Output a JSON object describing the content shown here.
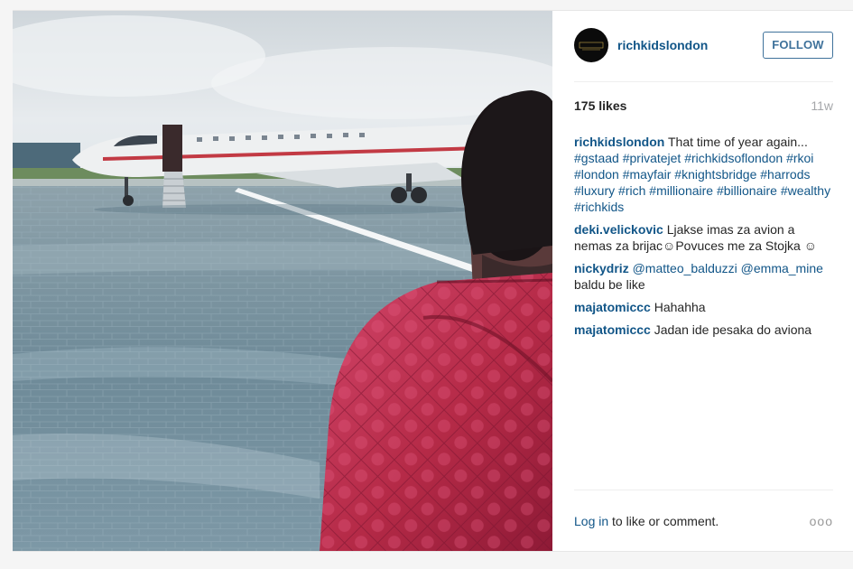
{
  "post": {
    "username": "richkidslondon",
    "avatar_text": "Rich Kids Of London",
    "follow_label": "FOLLOW",
    "likes": "175 likes",
    "time": "11w",
    "caption": {
      "user": "richkidslondon",
      "text": "That time of year again...",
      "hashtags": [
        "#gstaad",
        "#privatejet",
        "#richkidsoflondon",
        "#rkoi",
        "#london",
        "#mayfair",
        "#knightsbridge",
        "#harrods",
        "#luxury",
        "#rich",
        "#millionaire",
        "#billionaire",
        "#wealthy",
        "#richkids"
      ]
    },
    "comments": [
      {
        "user": "deki.velickovic",
        "text": "Ljakse imas za avion a nemas za brijac☺Povuces me za Stojka ☺"
      },
      {
        "user": "nickydriz",
        "mentions": [
          "@matteo_balduzzi",
          "@emma_mine"
        ],
        "text": "baldu be like"
      },
      {
        "user": "majatomiccc",
        "text": "Hahahha"
      },
      {
        "user": "majatomiccc",
        "text": "Jadan ide pesaka do aviona"
      }
    ],
    "footer": {
      "login_label": "Log in",
      "login_rest": "to like or comment.",
      "more_icon": "more-options-dots",
      "more_glyph": "ooo"
    }
  },
  "colors": {
    "link_blue": "#125688",
    "follow_blue": "#3f729b",
    "muted": "#a5a7aa",
    "jacket_red": "#b32445",
    "tarmac": "#6f8e9c"
  }
}
